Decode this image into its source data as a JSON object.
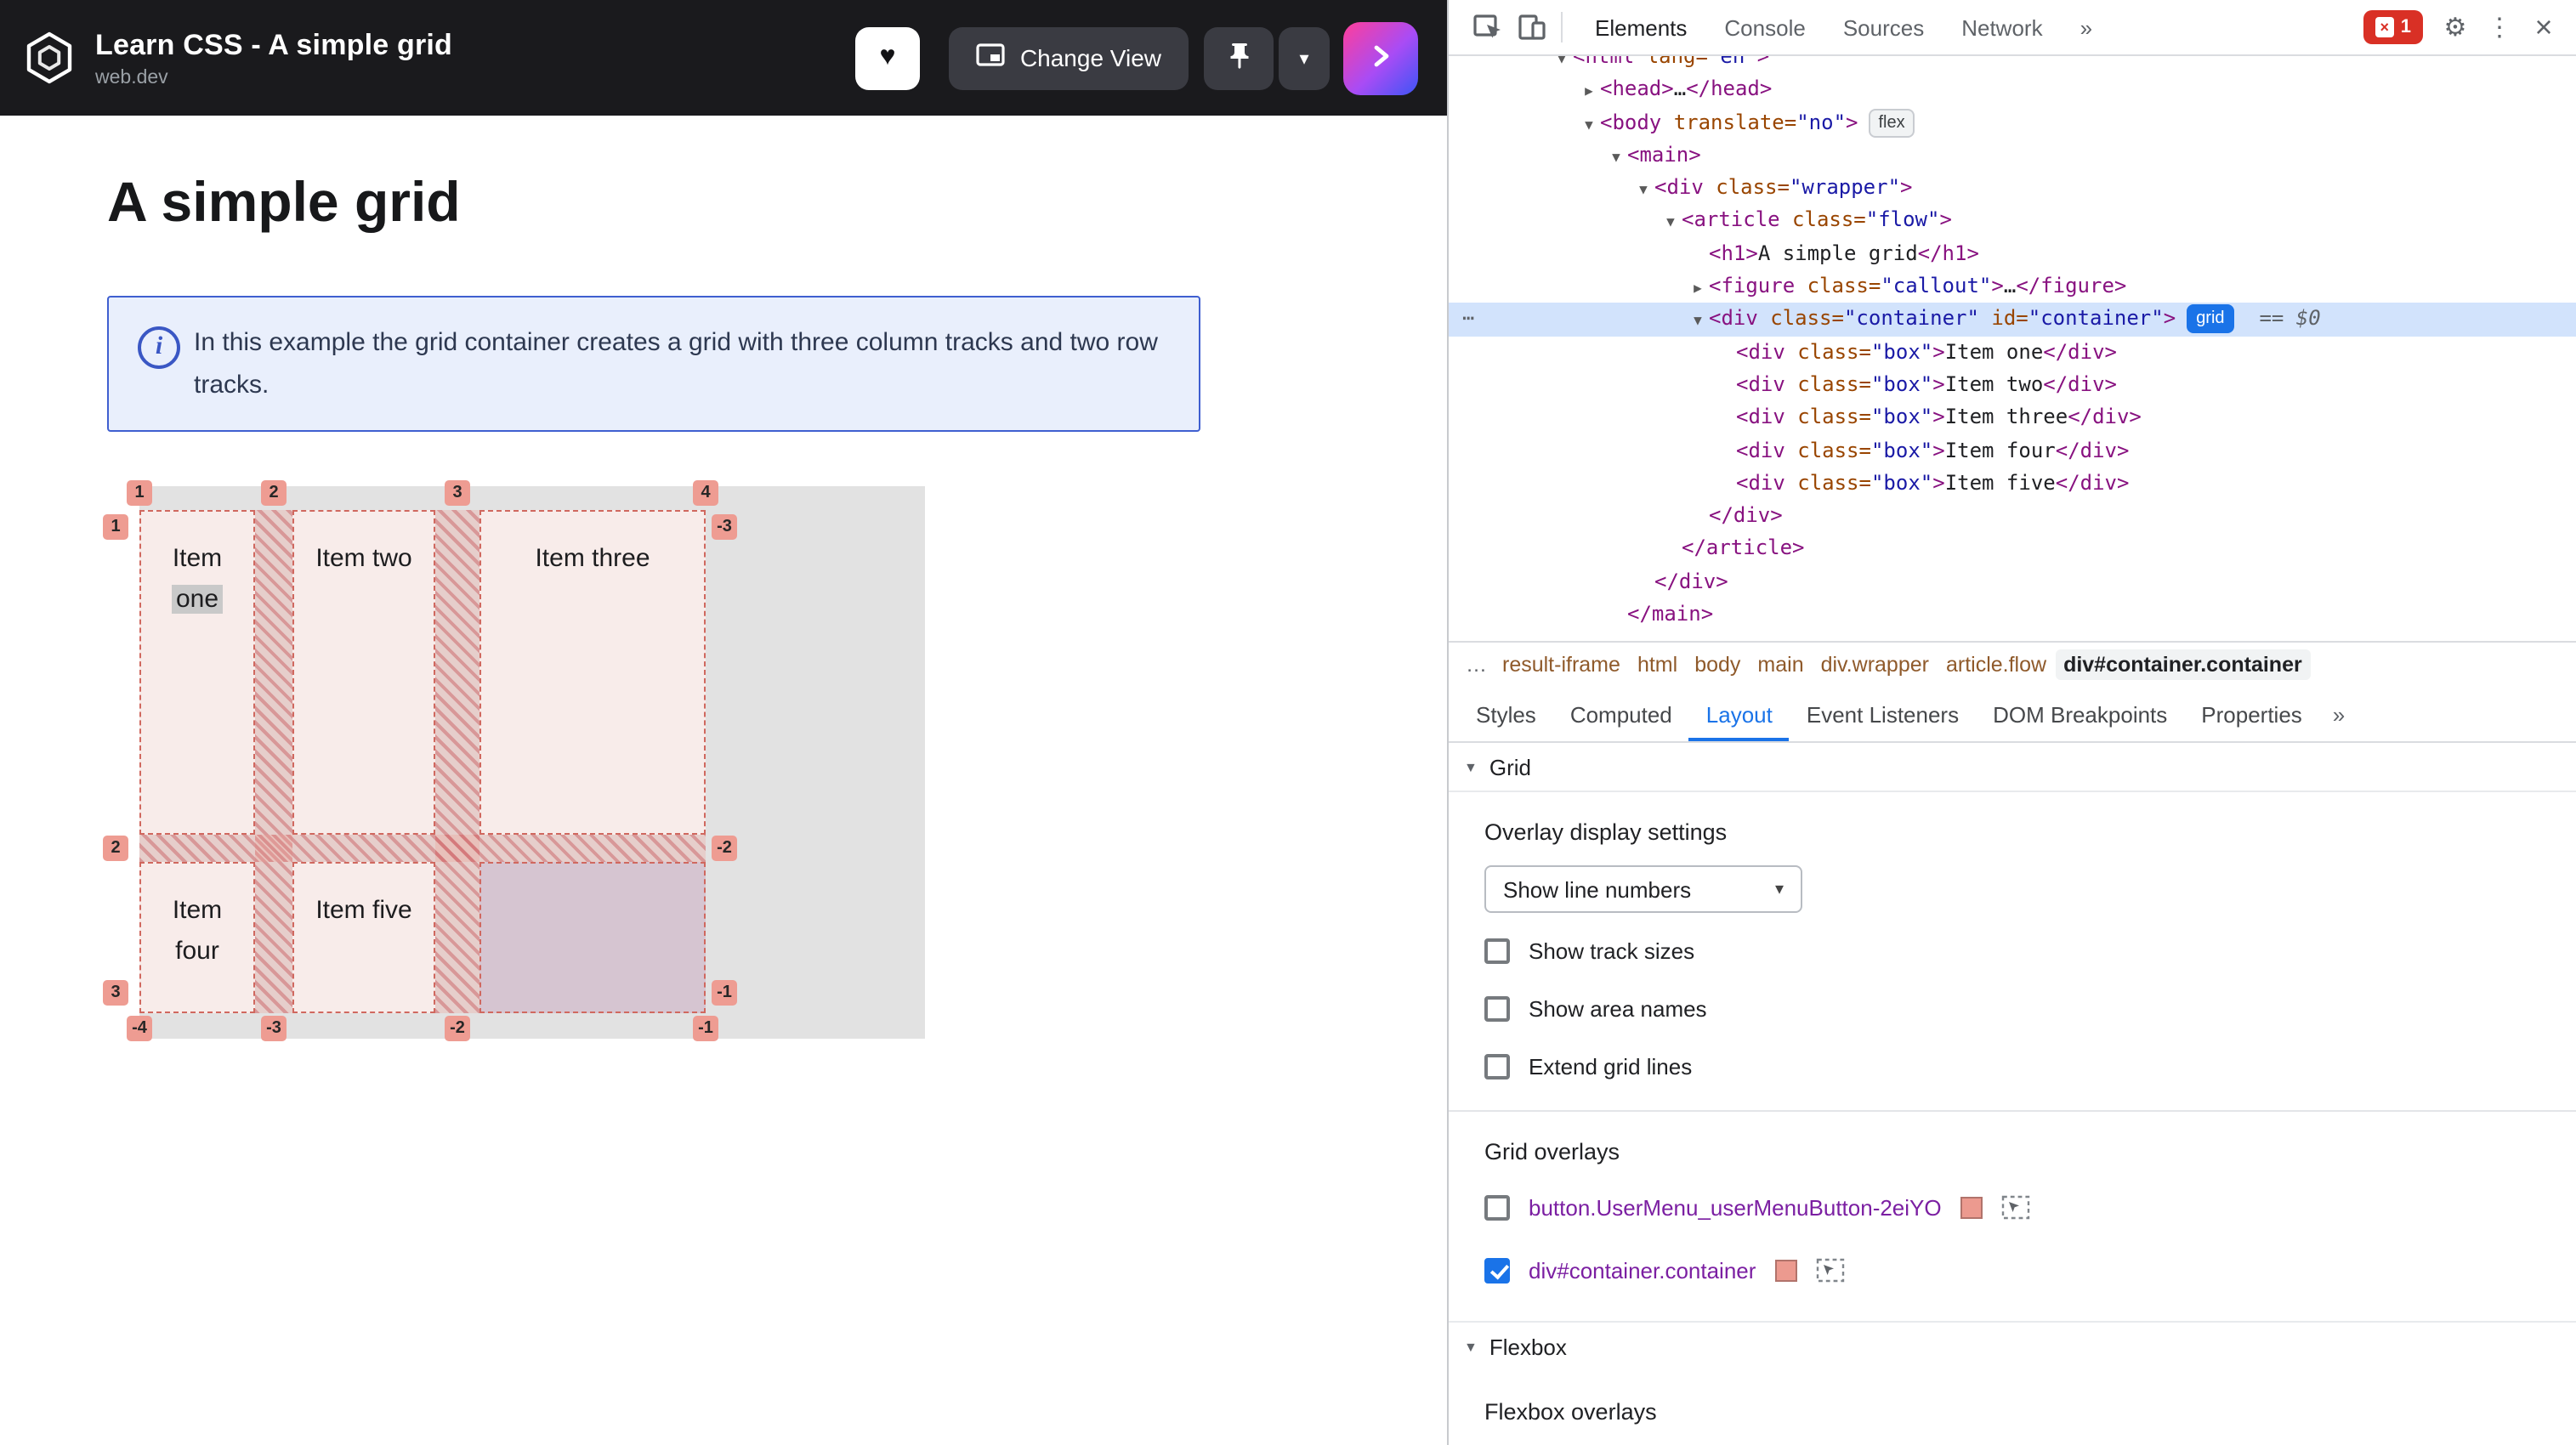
{
  "icons": {
    "heart": "♥",
    "chevron_down": "▾",
    "triangle_down": "▼",
    "gear": "⚙",
    "kebab": "⋮",
    "close": "×",
    "info": "i"
  },
  "header": {
    "title": "Learn CSS - A simple grid",
    "subtitle": "web.dev",
    "change_view_label": "Change View"
  },
  "content": {
    "heading": "A simple grid",
    "callout_text": "In this example the grid container creates a grid with three column tracks and two row tracks.",
    "grid": {
      "cells": [
        {
          "lines": [
            "Item",
            "one"
          ],
          "highlight_line": 1
        },
        {
          "lines": [
            "Item two"
          ]
        },
        {
          "lines": [
            "Item three"
          ]
        },
        {
          "lines": [
            "Item",
            "four"
          ]
        },
        {
          "lines": [
            "Item five"
          ]
        },
        {
          "lines": []
        }
      ],
      "line_numbers": {
        "top": [
          "1",
          "2",
          "3",
          "4"
        ],
        "bottom": [
          "-4",
          "-3",
          "-2",
          "-1"
        ],
        "left": [
          "1",
          "2",
          "3"
        ],
        "right": [
          "-3",
          "-2",
          "-1"
        ]
      }
    }
  },
  "devtools": {
    "toolbar": {
      "tabs": [
        "Elements",
        "Console",
        "Sources",
        "Network"
      ],
      "more": "»",
      "error_count": "1"
    },
    "dom": {
      "gutter_dots": "⋯",
      "lines": [
        {
          "indent": 0,
          "arrow": "▼",
          "tokens": [
            [
              "tag",
              "<html"
            ],
            [
              "attr",
              " lang="
            ],
            [
              "val",
              "\"en\""
            ],
            [
              "tag",
              ">"
            ]
          ]
        },
        {
          "indent": 1,
          "arrow": "▶",
          "tokens": [
            [
              "tag",
              "<head>"
            ],
            [
              "txt",
              "…"
            ],
            [
              "tag",
              "</head>"
            ]
          ]
        },
        {
          "indent": 1,
          "arrow": "▼",
          "tokens": [
            [
              "tag",
              "<body"
            ],
            [
              "attr",
              " translate="
            ],
            [
              "val",
              "\"no\""
            ],
            [
              "tag",
              ">"
            ],
            [
              "bflex",
              "flex"
            ]
          ]
        },
        {
          "indent": 2,
          "arrow": "▼",
          "tokens": [
            [
              "tag",
              "<main>"
            ]
          ]
        },
        {
          "indent": 3,
          "arrow": "▼",
          "tokens": [
            [
              "tag",
              "<div"
            ],
            [
              "attr",
              " class="
            ],
            [
              "val",
              "\"wrapper\""
            ],
            [
              "tag",
              ">"
            ]
          ]
        },
        {
          "indent": 4,
          "arrow": "▼",
          "tokens": [
            [
              "tag",
              "<article"
            ],
            [
              "attr",
              " class="
            ],
            [
              "val",
              "\"flow\""
            ],
            [
              "tag",
              ">"
            ]
          ]
        },
        {
          "indent": 5,
          "tokens": [
            [
              "tag",
              "<h1>"
            ],
            [
              "txt",
              "A simple grid"
            ],
            [
              "tag",
              "</h1>"
            ]
          ]
        },
        {
          "indent": 5,
          "arrow": "▶",
          "tokens": [
            [
              "tag",
              "<figure"
            ],
            [
              "attr",
              " class="
            ],
            [
              "val",
              "\"callout\""
            ],
            [
              "tag",
              ">"
            ],
            [
              "txt",
              "…"
            ],
            [
              "tag",
              "</figure>"
            ]
          ]
        },
        {
          "indent": 5,
          "arrow": "▼",
          "selected": true,
          "tokens": [
            [
              "tag",
              "<div"
            ],
            [
              "attr",
              " class="
            ],
            [
              "val",
              "\"container\""
            ],
            [
              "attr",
              " id="
            ],
            [
              "val",
              "\"container\""
            ],
            [
              "tag",
              ">"
            ],
            [
              "bgrid",
              "grid"
            ],
            [
              "dim",
              "  == $0"
            ]
          ]
        },
        {
          "indent": 6,
          "tokens": [
            [
              "tag",
              "<div"
            ],
            [
              "attr",
              " class="
            ],
            [
              "val",
              "\"box\""
            ],
            [
              "tag",
              ">"
            ],
            [
              "txt",
              "Item one"
            ],
            [
              "tag",
              "</div>"
            ]
          ]
        },
        {
          "indent": 6,
          "tokens": [
            [
              "tag",
              "<div"
            ],
            [
              "attr",
              " class="
            ],
            [
              "val",
              "\"box\""
            ],
            [
              "tag",
              ">"
            ],
            [
              "txt",
              "Item two"
            ],
            [
              "tag",
              "</div>"
            ]
          ]
        },
        {
          "indent": 6,
          "tokens": [
            [
              "tag",
              "<div"
            ],
            [
              "attr",
              " class="
            ],
            [
              "val",
              "\"box\""
            ],
            [
              "tag",
              ">"
            ],
            [
              "txt",
              "Item three"
            ],
            [
              "tag",
              "</div>"
            ]
          ]
        },
        {
          "indent": 6,
          "tokens": [
            [
              "tag",
              "<div"
            ],
            [
              "attr",
              " class="
            ],
            [
              "val",
              "\"box\""
            ],
            [
              "tag",
              ">"
            ],
            [
              "txt",
              "Item four"
            ],
            [
              "tag",
              "</div>"
            ]
          ]
        },
        {
          "indent": 6,
          "tokens": [
            [
              "tag",
              "<div"
            ],
            [
              "attr",
              " class="
            ],
            [
              "val",
              "\"box\""
            ],
            [
              "tag",
              ">"
            ],
            [
              "txt",
              "Item five"
            ],
            [
              "tag",
              "</div>"
            ]
          ]
        },
        {
          "indent": 5,
          "tokens": [
            [
              "tag",
              "</div>"
            ]
          ]
        },
        {
          "indent": 4,
          "tokens": [
            [
              "tag",
              "</article>"
            ]
          ]
        },
        {
          "indent": 3,
          "tokens": [
            [
              "tag",
              "</div>"
            ]
          ]
        },
        {
          "indent": 2,
          "tokens": [
            [
              "tag",
              "</main>"
            ]
          ]
        }
      ]
    },
    "crumbs": {
      "ellipsis": "…",
      "items": [
        "result-iframe",
        "html",
        "body",
        "main",
        "div.wrapper",
        "article.flow",
        "div#container.container"
      ],
      "active_index": 6
    },
    "sidebar_tabs": {
      "tabs": [
        "Styles",
        "Computed",
        "Layout",
        "Event Listeners",
        "DOM Breakpoints",
        "Properties"
      ],
      "more": "»"
    },
    "layout_pane": {
      "grid_section": "Grid",
      "overlay_display_settings": "Overlay display settings",
      "line_numbers_select": "Show line numbers",
      "checkboxes": [
        "Show track sizes",
        "Show area names",
        "Extend grid lines"
      ],
      "grid_overlays_title": "Grid overlays",
      "overlays": [
        {
          "label": "button.UserMenu_userMenuButton-2eiYO",
          "checked": false
        },
        {
          "label": "div#container.container",
          "checked": true
        }
      ],
      "flexbox_section": "Flexbox",
      "flexbox_overlays_title": "Flexbox overlays"
    }
  },
  "colors": {
    "devtools_accent": "#1a73e8",
    "grid_overlay_salmon": "#ee9c92",
    "header_bg": "#1a1a1d"
  }
}
